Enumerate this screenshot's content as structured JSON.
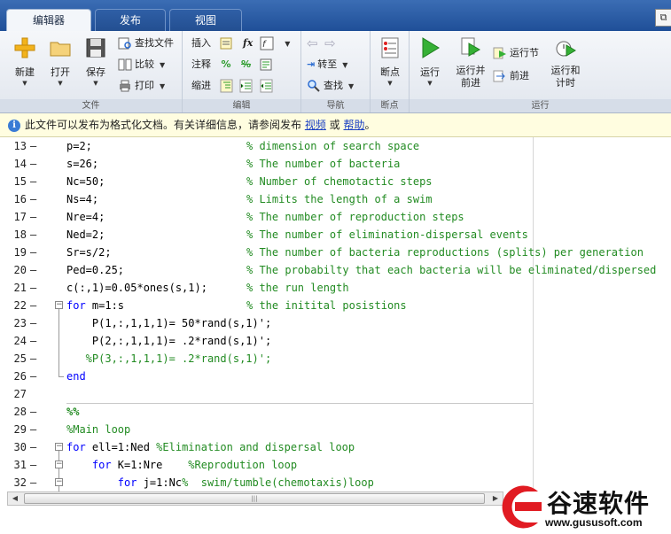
{
  "tabs": [
    {
      "label": "编辑器",
      "active": true
    },
    {
      "label": "发布",
      "active": false
    },
    {
      "label": "视图",
      "active": false
    }
  ],
  "ribbon": {
    "file": {
      "group_label": "文件",
      "new_label": "新建",
      "open_label": "打开",
      "save_label": "保存",
      "find_files_label": "查找文件",
      "compare_label": "比较",
      "print_label": "打印"
    },
    "edit": {
      "group_label": "编辑",
      "insert_label": "插入",
      "comment_label": "注释",
      "indent_label": "缩进"
    },
    "navigate": {
      "group_label": "导航",
      "goto_label": "转至",
      "find_label": "查找"
    },
    "breakpoints": {
      "group_label": "断点",
      "breakpoints_label": "断点"
    },
    "run": {
      "group_label": "运行",
      "run_label": "运行",
      "run_advance_label": "运行并\n前进",
      "run_section_label": "运行节",
      "advance_label": "前进",
      "run_time_label": "运行和\n计时"
    }
  },
  "infobar": {
    "text_before": "此文件可以发布为格式化文档。有关详细信息，请参阅发布 ",
    "link_video": "视频",
    "text_mid": " 或 ",
    "link_help": "帮助",
    "text_after": "。"
  },
  "code_lines": [
    {
      "num": "13",
      "code": "p=2;",
      "comment": "% dimension of search space"
    },
    {
      "num": "14",
      "code": "s=26;",
      "comment": "% The number of bacteria"
    },
    {
      "num": "15",
      "code": "Nc=50;",
      "comment": "% Number of chemotactic steps"
    },
    {
      "num": "16",
      "code": "Ns=4;",
      "comment": "% Limits the length of a swim"
    },
    {
      "num": "17",
      "code": "Nre=4;",
      "comment": "% The number of reproduction steps"
    },
    {
      "num": "18",
      "code": "Ned=2;",
      "comment": "% The number of elimination-dispersal events"
    },
    {
      "num": "19",
      "code": "Sr=s/2;",
      "comment": "% The number of bacteria reproductions (splits) per generation"
    },
    {
      "num": "20",
      "code": "Ped=0.25;",
      "comment": "% The probabilty that each bacteria will be eliminated/dispersed"
    },
    {
      "num": "21",
      "code": "c(:,1)=0.05*ones(s,1);",
      "comment": "% the run length"
    },
    {
      "num": "22",
      "kw": "for",
      "code": " m=1:s",
      "comment": "% the initital posistions"
    },
    {
      "num": "23",
      "code": "    P(1,:,1,1,1)= 50*rand(s,1)';"
    },
    {
      "num": "24",
      "code": "    P(2,:,1,1,1)= .2*rand(s,1)';"
    },
    {
      "num": "25",
      "greencode": "   %P(3,:,1,1,1)= .2*rand(s,1)';"
    },
    {
      "num": "26",
      "kw": "end",
      "code": ""
    },
    {
      "num": "27",
      "code": ""
    },
    {
      "num": "28",
      "greencode": "%%"
    },
    {
      "num": "29",
      "greencode": "%Main loop"
    },
    {
      "num": "30",
      "kw": "for",
      "code": " ell=1:Ned ",
      "inline_comment": "%Elimination and dispersal loop"
    },
    {
      "num": "31",
      "kw": "    for",
      "code": " K=1:Nre    ",
      "inline_comment": "%Reprodution loop"
    },
    {
      "num": "32",
      "kw": "        for",
      "code": " j=1:Nc",
      "inline_comment": "%  swim/tumble(chemotaxis)loop"
    }
  ],
  "watermark": {
    "name": "谷速软件",
    "url": "www.gususoft.com"
  },
  "colors": {
    "keyword": "#0000ff",
    "comment": "#228b22",
    "tabbar": "#1f4f98",
    "watermark_red": "#e11b22"
  }
}
